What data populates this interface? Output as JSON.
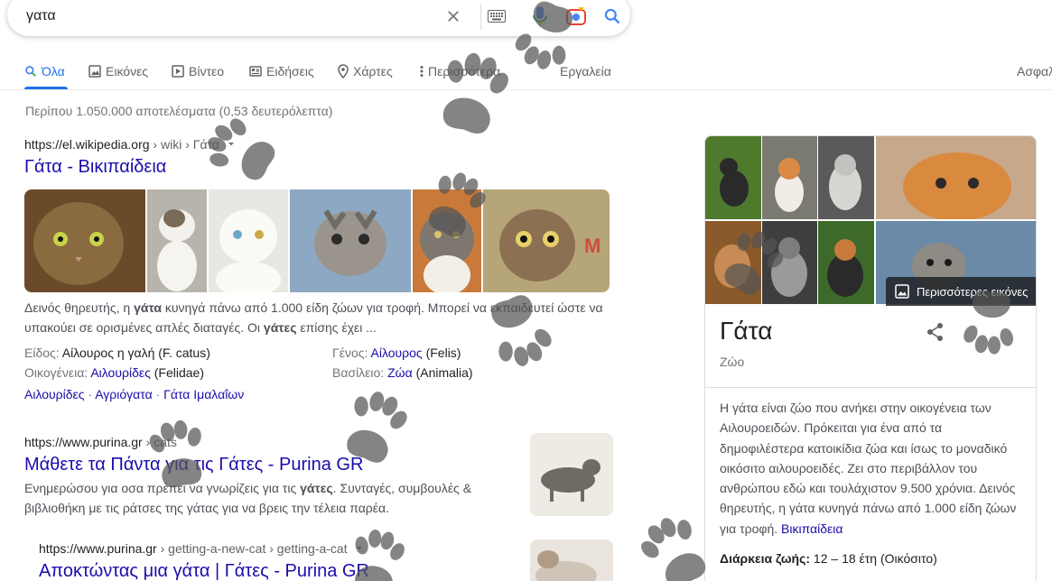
{
  "search": {
    "query": "γατα"
  },
  "tabs": [
    {
      "label": "Όλα",
      "icon": "search-icon",
      "active": true
    },
    {
      "label": "Εικόνες",
      "icon": "image-icon"
    },
    {
      "label": "Βίντεο",
      "icon": "play-icon"
    },
    {
      "label": "Ειδήσεις",
      "icon": "news-icon"
    },
    {
      "label": "Χάρτες",
      "icon": "map-pin-icon"
    },
    {
      "label": "Περισσότερα",
      "icon": "more-vert-icon"
    },
    {
      "label": "Εργαλεία"
    },
    {
      "label": "Ασφαλ"
    }
  ],
  "stats": "Περίπου 1.050.000 αποτελέσματα (0,53 δευτερόλεπτα)",
  "results": [
    {
      "site": "https://el.wikipedia.org",
      "path": " › wiki › Γάτα",
      "title": "Γάτα - Βικιπαίδεια",
      "snippet_parts": [
        "Δεινός θηρευτής, η ",
        "γάτα",
        " κυνηγά πάνω από 1.000 είδη ζώων για τροφή. Μπορεί να εκπαιδευτεί ώστε να υπακούει σε ορισμένες απλές διαταγές. Οι ",
        "γάτες",
        " επίσης έχει ..."
      ],
      "facts": [
        {
          "label": "Είδος: ",
          "value": "Αίλουρος η γαλή",
          "suffix": " (F. catus)",
          "link": false
        },
        {
          "label": "Γένος: ",
          "value": "Αίλουρος",
          "suffix": " (Felis)",
          "link": true
        },
        {
          "label": "Οικογένεια: ",
          "value": "Αιλουρίδες",
          "suffix": " (Felidae)",
          "link": true
        },
        {
          "label": "Βασίλειο: ",
          "value": "Ζώα",
          "suffix": " (Animalia)",
          "link": true
        }
      ],
      "related": [
        "Αιλουρίδες",
        "Αγριόγατα",
        "Γάτα Ιμαλαΐων"
      ]
    },
    {
      "site": "https://www.purina.gr",
      "path": " › cats",
      "title": "Μάθετε τα Πάντα για τις Γάτες - Purina GR",
      "snippet_parts": [
        "Ενημερώσου για οσα πρέπει να γνωρίζεις για τις ",
        "γάτες",
        ". Συνταγές, συμβουλές & βιβλιοθήκη με τις ράτσες της γάτας για να βρεις την τέλεια παρέα."
      ]
    },
    {
      "site": "https://www.purina.gr",
      "path": " › getting-a-new-cat › getting-a-cat",
      "title": "Αποκτώντας μια γάτα | Γάτες - Purina GR"
    }
  ],
  "knowledge_panel": {
    "more_images": "Περισσότερες εικόνες",
    "title": "Γάτα",
    "subtitle": "Ζώο",
    "description": "Η γάτα είναι ζώο που ανήκει στην οικογένεια των Αιλουροειδών. Πρόκειται για ένα από τα δημοφιλέστερα κατοικίδια ζώα και ίσως το μοναδικό οικόσιτο αιλουροειδές. Ζει στο περιβάλλον του ανθρώπου εδώ και τουλάχιστον 9.500 χρόνια. Δεινός θηρευτής, η γάτα κυνηγά πάνω από 1.000 είδη ζώων για τροφή.",
    "source": "Βικιπαίδεια",
    "lifespan_label": "Διάρκεια ζωής:",
    "lifespan_value": " 12 – 18 έτη (Οικόσιτο)"
  },
  "colors": {
    "link": "#1a0dab",
    "accent": "#1a73e8",
    "paw": "#555555"
  }
}
